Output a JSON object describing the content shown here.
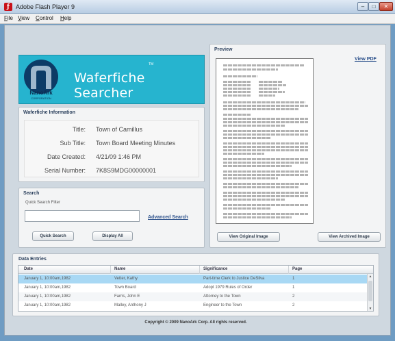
{
  "window": {
    "title": "Adobe Flash Player 9"
  },
  "menu": [
    {
      "label": "File",
      "underline": "F",
      "rest": "ile"
    },
    {
      "label": "View",
      "underline": "V",
      "rest": "iew"
    },
    {
      "label": "Control",
      "underline": "C",
      "rest": "ontrol"
    },
    {
      "label": "Help",
      "underline": "H",
      "rest": "elp"
    }
  ],
  "banner": {
    "title": "Waferfiche Searcher",
    "tm": "TM",
    "logo_name": "NanoArk",
    "logo_sub": "CORPORATION",
    "color": "#26b4cf"
  },
  "info": {
    "heading": "Waferfiche Information",
    "rows": [
      {
        "label": "Title:",
        "value": "Town of Camillus"
      },
      {
        "label": "Sub Title:",
        "value": "Town Board Meeting Minutes"
      },
      {
        "label": "Date Created:",
        "value": "4/21/09 1:46 PM"
      },
      {
        "label": "Serial Number:",
        "value": "7K8S9MDG00000001"
      }
    ]
  },
  "search": {
    "heading": "Search",
    "filter_label": "Quick Search Filter",
    "input_value": "",
    "advanced_link": "Advanced Search",
    "quick_button": "Quick Search",
    "display_all_button": "Display All"
  },
  "preview": {
    "heading": "Preview",
    "view_pdf": "View PDF",
    "view_original": "View Original Image",
    "view_archived": "View Archived Image"
  },
  "data_entries": {
    "heading": "Data Entries",
    "columns": [
      "Date",
      "Name",
      "Significance",
      "Page"
    ],
    "rows": [
      [
        "January 1, 10:00am,1982",
        "Vetter, Kathy",
        "Part-time Clerk to Justice DeSilva",
        "1"
      ],
      [
        "January 1, 10:00am,1982",
        "Town Board",
        "Adopt 1979 Rules of Order",
        "1"
      ],
      [
        "January 1, 10:00am,1982",
        "Farris, John E",
        "Attorney to the Town",
        "2"
      ],
      [
        "January 1, 10:00am,1982",
        "Malley, Anthony J",
        "Engineer to the Town",
        "2"
      ]
    ],
    "selected_row": 0,
    "selection_color": "#a8d8f4"
  },
  "footer": "Copyright © 2009 NanoArk Corp. All rights reserved."
}
